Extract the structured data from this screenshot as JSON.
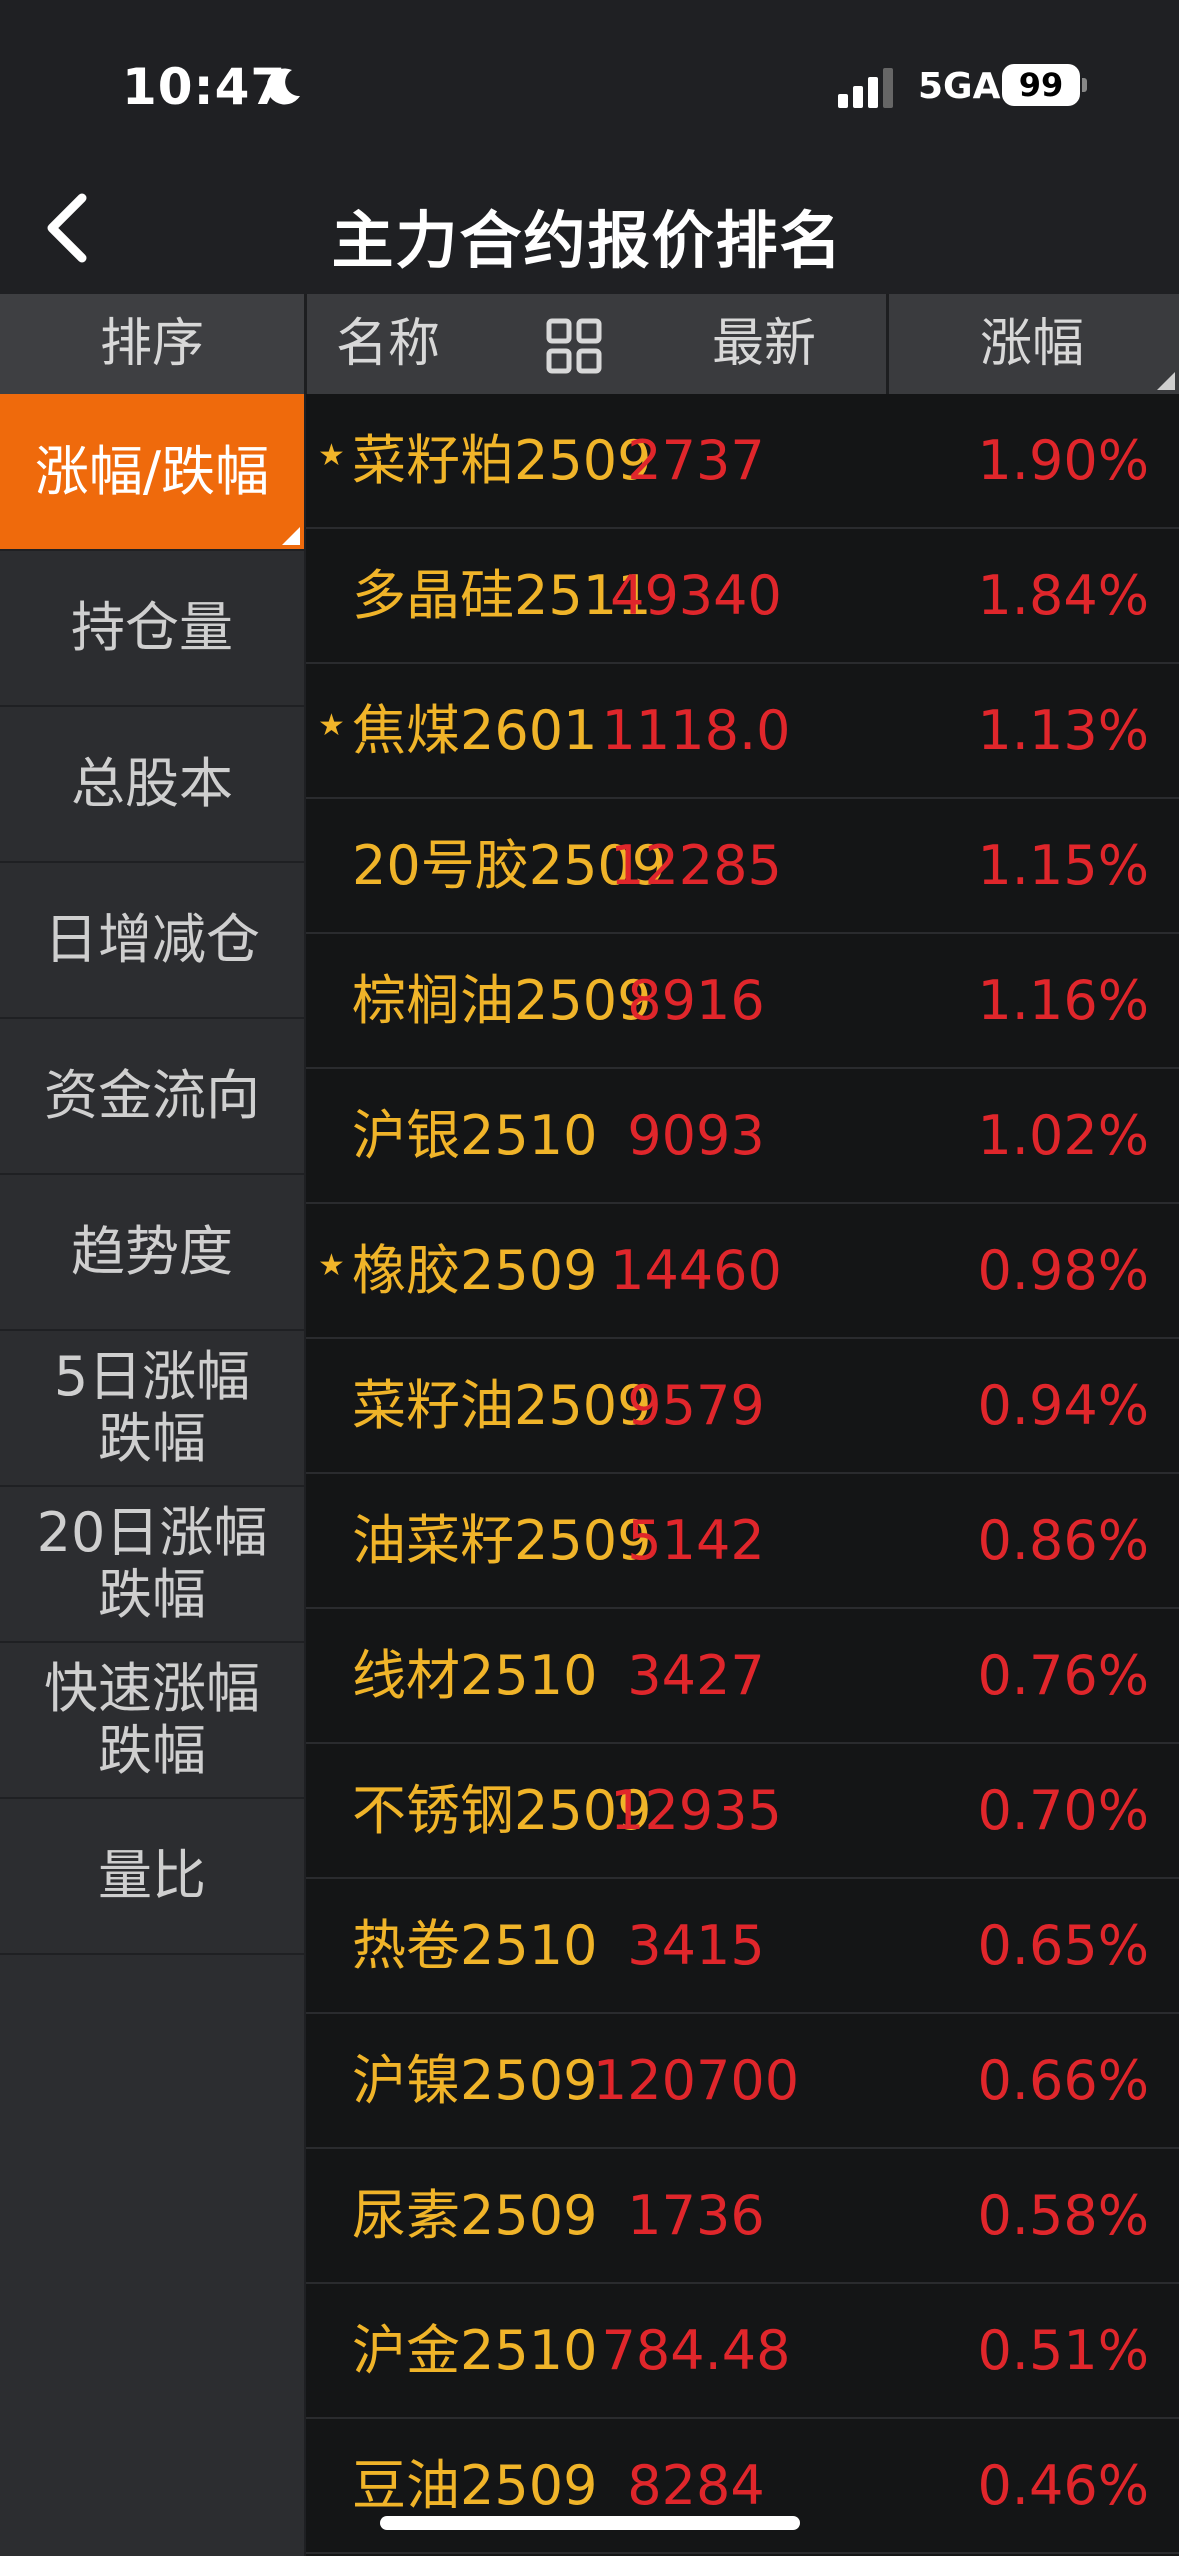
{
  "status": {
    "time": "10:47",
    "network": "5GA",
    "battery": "99"
  },
  "nav": {
    "title": "主力合约报价排名"
  },
  "header": {
    "sort": "排序",
    "name": "名称",
    "latest": "最新",
    "change": "涨幅"
  },
  "sidebar": {
    "items": [
      {
        "label": "涨幅/跌幅",
        "active": true
      },
      {
        "label": "持仓量",
        "active": false
      },
      {
        "label": "总股本",
        "active": false
      },
      {
        "label": "日增减仓",
        "active": false
      },
      {
        "label": "资金流向",
        "active": false
      },
      {
        "label": "趋势度",
        "active": false
      },
      {
        "label": "5日涨幅\n跌幅",
        "active": false
      },
      {
        "label": "20日涨幅\n跌幅",
        "active": false
      },
      {
        "label": "快速涨幅\n跌幅",
        "active": false
      },
      {
        "label": "量比",
        "active": false
      }
    ]
  },
  "rows": [
    {
      "star": true,
      "name": "菜籽粕2509",
      "latest": "2737",
      "change": "1.90%"
    },
    {
      "star": false,
      "name": "多晶硅2511",
      "latest": "49340",
      "change": "1.84%"
    },
    {
      "star": true,
      "name": "焦煤2601",
      "latest": "1118.0",
      "change": "1.13%"
    },
    {
      "star": false,
      "name": "20号胶2509",
      "latest": "12285",
      "change": "1.15%"
    },
    {
      "star": false,
      "name": "棕榈油2509",
      "latest": "8916",
      "change": "1.16%"
    },
    {
      "star": false,
      "name": "沪银2510",
      "latest": "9093",
      "change": "1.02%"
    },
    {
      "star": true,
      "name": "橡胶2509",
      "latest": "14460",
      "change": "0.98%"
    },
    {
      "star": false,
      "name": "菜籽油2509",
      "latest": "9579",
      "change": "0.94%"
    },
    {
      "star": false,
      "name": "油菜籽2509",
      "latest": "5142",
      "change": "0.86%"
    },
    {
      "star": false,
      "name": "线材2510",
      "latest": "3427",
      "change": "0.76%"
    },
    {
      "star": false,
      "name": "不锈钢2509",
      "latest": "12935",
      "change": "0.70%"
    },
    {
      "star": false,
      "name": "热卷2510",
      "latest": "3415",
      "change": "0.65%"
    },
    {
      "star": false,
      "name": "沪镍2509",
      "latest": "120700",
      "change": "0.66%"
    },
    {
      "star": false,
      "name": "尿素2509",
      "latest": "1736",
      "change": "0.58%"
    },
    {
      "star": false,
      "name": "沪金2510",
      "latest": "784.48",
      "change": "0.51%"
    },
    {
      "star": false,
      "name": "豆油2509",
      "latest": "8284",
      "change": "0.46%"
    }
  ],
  "colors": {
    "accent": "#ef6a0c",
    "up": "#e0262b",
    "name": "#f0b429"
  }
}
